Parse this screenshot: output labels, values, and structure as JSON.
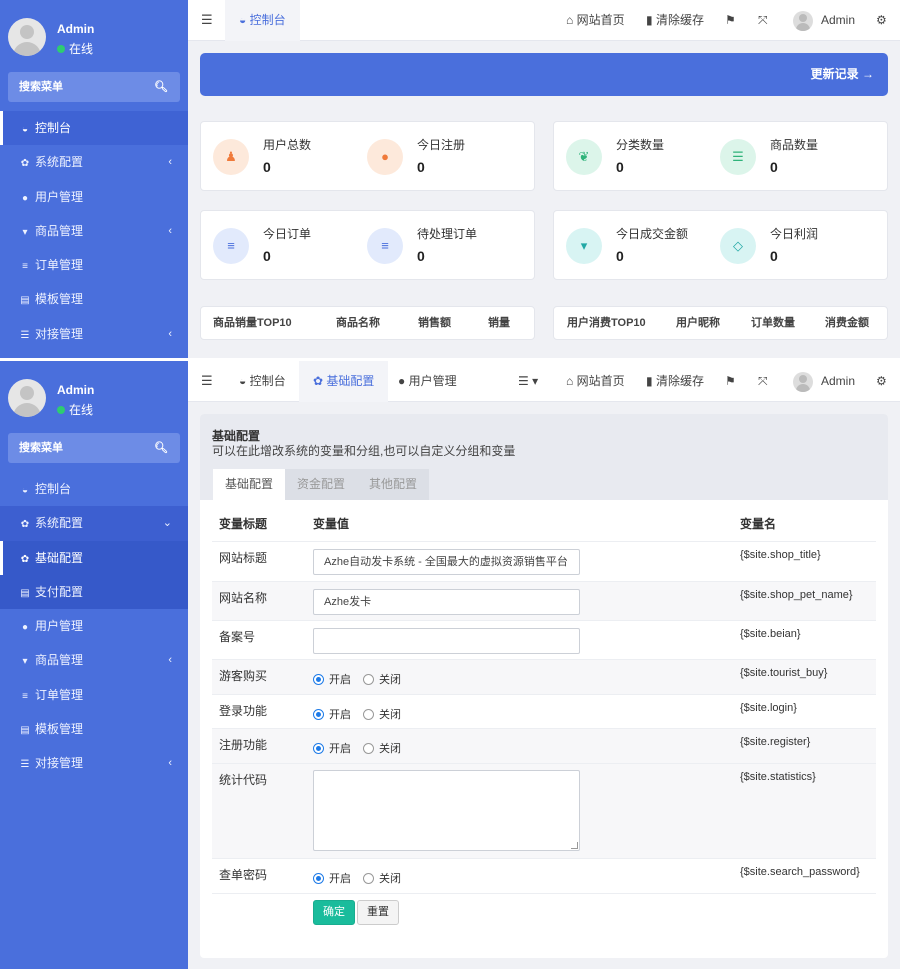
{
  "sidebar": {
    "user_name": "Admin",
    "status": "在线",
    "search_placeholder": "搜索菜单",
    "menu": [
      {
        "label": "控制台",
        "icon": "dashboard-icon"
      },
      {
        "label": "系统配置",
        "icon": "gear-icon"
      },
      {
        "label": "用户管理",
        "icon": "user-icon"
      },
      {
        "label": "商品管理",
        "icon": "cart-icon"
      },
      {
        "label": "订单管理",
        "icon": "list-icon"
      },
      {
        "label": "模板管理",
        "icon": "keyboard-icon"
      },
      {
        "label": "对接管理",
        "icon": "sliders-icon"
      }
    ],
    "submenu": [
      {
        "label": "基础配置",
        "icon": "gear-icon"
      },
      {
        "label": "支付配置",
        "icon": "credit-card-icon"
      }
    ]
  },
  "topbar": {
    "home": "网站首页",
    "clear_cache": "清除缓存",
    "admin": "Admin",
    "tabs1": [
      "控制台"
    ],
    "tabs2": [
      "控制台",
      "基础配置",
      "用户管理"
    ]
  },
  "dashboard": {
    "banner": "更新记录 →",
    "stats": [
      {
        "label": "用户总数",
        "value": "0",
        "icon": "users-icon",
        "color": "#f07a3a"
      },
      {
        "label": "今日注册",
        "value": "0",
        "icon": "user-icon",
        "color": "#f07a3a"
      },
      {
        "label": "分类数量",
        "value": "0",
        "icon": "leaf-icon",
        "color": "#2fb37a"
      },
      {
        "label": "商品数量",
        "value": "0",
        "icon": "list-icon",
        "color": "#2fb37a"
      },
      {
        "label": "今日订单",
        "value": "0",
        "icon": "bars-icon",
        "color": "#4a6fdc"
      },
      {
        "label": "待处理订单",
        "value": "0",
        "icon": "bars-icon",
        "color": "#4a6fdc"
      },
      {
        "label": "今日成交金额",
        "value": "0",
        "icon": "cart-icon",
        "color": "#23a8a5"
      },
      {
        "label": "今日利润",
        "value": "0",
        "icon": "diamond-icon",
        "color": "#23a8a5"
      }
    ],
    "goods_table_headers": [
      "商品销量TOP10",
      "商品名称",
      "销售额",
      "销量"
    ],
    "users_table_headers": [
      "用户消费TOP10",
      "用户昵称",
      "订单数量",
      "消费金额"
    ]
  },
  "config": {
    "title": "基础配置",
    "subtitle": "可以在此增改系统的变量和分组,也可以自定义分组和变量",
    "tabs": [
      "基础配置",
      "资金配置",
      "其他配置"
    ],
    "headers": {
      "title": "变量标题",
      "value": "变量值",
      "name": "变量名"
    },
    "rows": [
      {
        "label": "网站标题",
        "value": "Azhe自动发卡系统 - 全国最大的虚拟资源销售平台",
        "var": "{$site.shop_title}"
      },
      {
        "label": "网站名称",
        "value": "Azhe发卡",
        "var": "{$site.shop_pet_name}"
      },
      {
        "label": "备案号",
        "value": "",
        "var": "{$site.beian}"
      },
      {
        "label": "游客购买",
        "var": "{$site.tourist_buy}"
      },
      {
        "label": "登录功能",
        "var": "{$site.login}"
      },
      {
        "label": "注册功能",
        "var": "{$site.register}"
      },
      {
        "label": "统计代码",
        "value": "",
        "var": "{$site.statistics}"
      },
      {
        "label": "查单密码",
        "var": "{$site.search_password}"
      }
    ],
    "radio_on": "开启",
    "radio_off": "关闭",
    "submit": "确定",
    "reset": "重置"
  }
}
